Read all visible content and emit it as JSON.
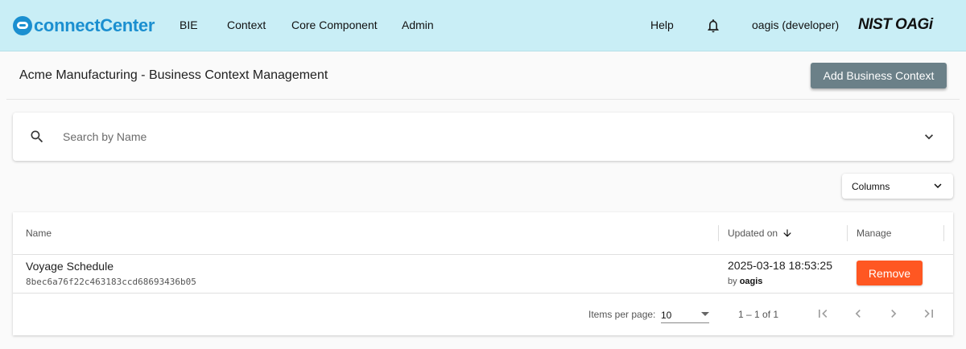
{
  "brand": {
    "logo_text": "connectCenter",
    "org_logo_text": "NIST OAGi"
  },
  "nav": {
    "bie": "BIE",
    "context": "Context",
    "core_component": "Core Component",
    "admin": "Admin",
    "help": "Help"
  },
  "user": {
    "label": "oagis (developer)"
  },
  "page": {
    "title": "Acme Manufacturing - Business Context Management",
    "add_button": "Add Business Context"
  },
  "search": {
    "placeholder": "Search by Name",
    "value": ""
  },
  "columns_button": {
    "label": "Columns"
  },
  "table": {
    "headers": {
      "name": "Name",
      "updated_on": "Updated on",
      "manage": "Manage"
    },
    "rows": [
      {
        "name": "Voyage Schedule",
        "guid": "8bec6a76f22c463183ccd68693436b05",
        "updated_on": "2025-03-18 18:53:25",
        "by_prefix": "by",
        "updated_by": "oagis",
        "action": "Remove"
      }
    ]
  },
  "paginator": {
    "items_per_page_label": "Items per page:",
    "page_size": "10",
    "range": "1 – 1 of 1"
  },
  "colors": {
    "topbar": "#c9eef6",
    "brand": "#1b8fd0",
    "primary_button": "#6b8088",
    "danger": "#ff5722"
  },
  "icons": {
    "notifications": "bell-icon",
    "search": "search-icon",
    "expand": "chevron-down-icon",
    "sort": "arrow-down-icon",
    "first": "first-page-icon",
    "prev": "chevron-left-icon",
    "next": "chevron-right-icon",
    "last": "last-page-icon"
  }
}
